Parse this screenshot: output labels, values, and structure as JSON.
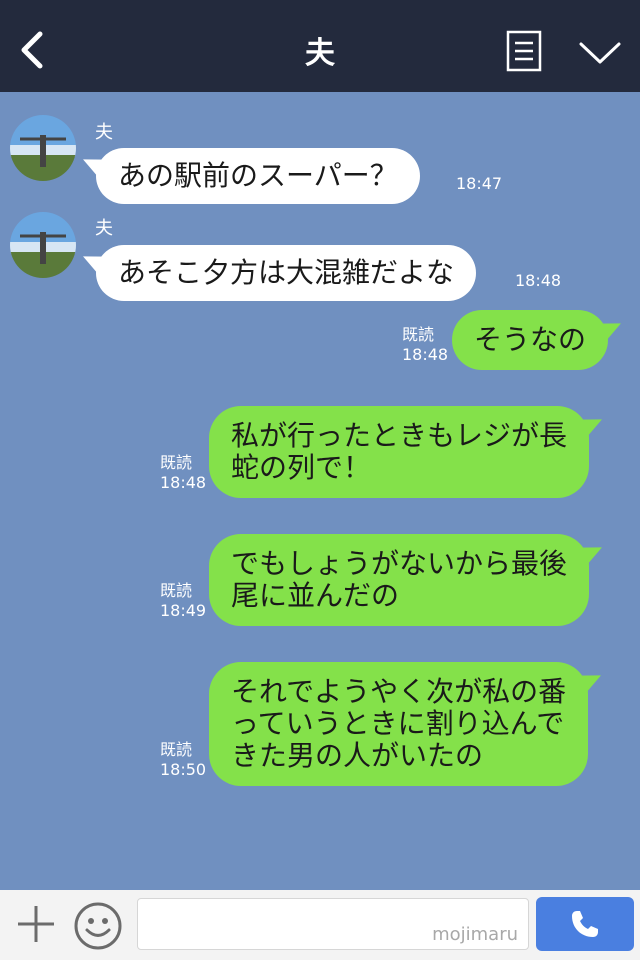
{
  "header": {
    "title": "夫",
    "back_icon": "chevron-left-icon",
    "menu_icon": "list-icon",
    "collapse_icon": "chevron-down-icon"
  },
  "messages": [
    {
      "side": "left",
      "sender": "夫",
      "text": "あの駅前のスーパー？",
      "time": "18:47"
    },
    {
      "side": "left",
      "sender": "夫",
      "text": "あそこ夕方は大混雑だよな",
      "time": "18:48"
    },
    {
      "side": "right",
      "read": "既読",
      "time": "18:48",
      "text": "そうなの"
    },
    {
      "side": "right",
      "read": "既読",
      "time": "18:48",
      "lines": [
        "私が行ったときもレジが長",
        "蛇の列で！"
      ]
    },
    {
      "side": "right",
      "read": "既読",
      "time": "18:49",
      "lines": [
        "でもしょうがないから最後",
        "尾に並んだの"
      ]
    },
    {
      "side": "right",
      "read": "既読",
      "time": "18:50",
      "lines": [
        "それでようやく次が私の番",
        "っていうときに割り込んで",
        "きた男の人がいたの"
      ]
    }
  ],
  "footer": {
    "plus_icon": "plus-icon",
    "emoji_icon": "smiley-icon",
    "input_value": "",
    "watermark": "mojimaru",
    "send_icon": "phone-icon"
  },
  "colors": {
    "header_bg": "#232a3d",
    "chat_bg": "#7090c0",
    "outgoing_bubble": "#84e14a",
    "incoming_bubble": "#ffffff",
    "send_button": "#4a7fe0"
  }
}
